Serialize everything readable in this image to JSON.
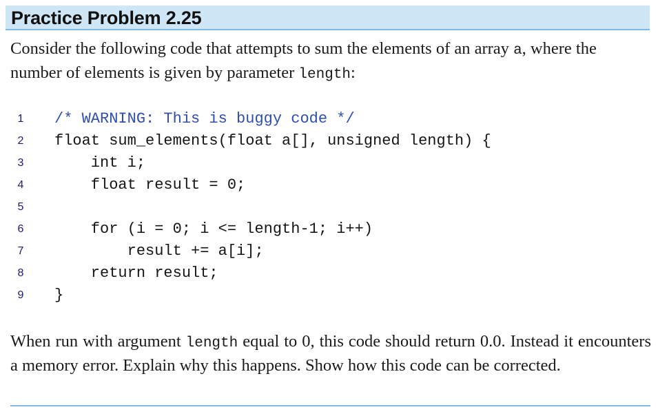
{
  "header": {
    "title": "Practice Problem 2.25"
  },
  "intro": {
    "text_before": "Consider the following code that attempts to sum the elements of an array ",
    "array_var": "a",
    "text_middle": ", where the number of elements is given by parameter ",
    "param_name": "length",
    "text_after": ":"
  },
  "code": {
    "lines": [
      {
        "num": "1",
        "text": "/* WARNING: This is buggy code */"
      },
      {
        "num": "2",
        "text": "float sum_elements(float a[], unsigned length) {"
      },
      {
        "num": "3",
        "text": "    int i;"
      },
      {
        "num": "4",
        "text": "    float result = 0;"
      },
      {
        "num": "5",
        "text": ""
      },
      {
        "num": "6",
        "text": "    for (i = 0; i <= length-1; i++)"
      },
      {
        "num": "7",
        "text": "        result += a[i];"
      },
      {
        "num": "8",
        "text": "    return result;"
      },
      {
        "num": "9",
        "text": "}"
      }
    ]
  },
  "outro": {
    "text_before": "When run with argument ",
    "param_name": "length",
    "text_after": " equal to 0, this code should return 0.0. Instead it encounters a memory error. Explain why this happens. Show how this code can be corrected."
  },
  "colors": {
    "header_bg": "#cfe6f6",
    "rule": "#7fb8e2",
    "comment": "#2f4fa8",
    "line_number": "#1b1b6e"
  }
}
